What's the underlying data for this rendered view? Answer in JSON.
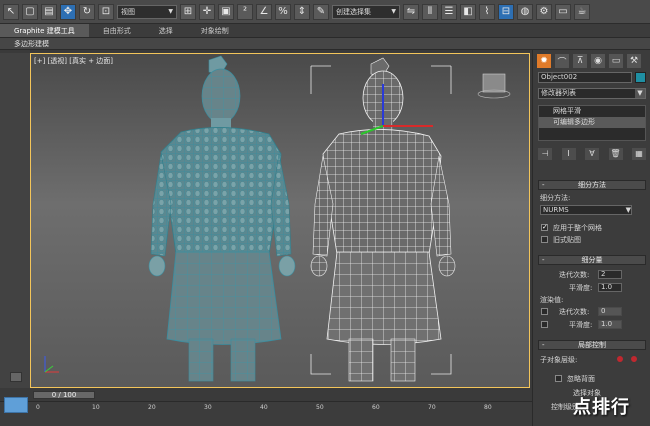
{
  "toolbar": {
    "view_dropdown": "视图",
    "named_selection": "创建选择集"
  },
  "ribbon": {
    "tabs": [
      "Graphite 建模工具",
      "自由形式",
      "选择",
      "对象绘制"
    ],
    "active_tab": "Graphite 建模工具",
    "sub_panel": "多边形建模"
  },
  "viewport": {
    "label": "[+] [透视] [真实 + 边面]"
  },
  "command_panel": {
    "object_name": "Object002",
    "object_color": "#1f8fa3",
    "modifier_list": "修改器列表",
    "stack": [
      "网格平滑",
      "可编辑多边形"
    ],
    "subdivision_method": {
      "header": "细分方法",
      "method_label": "细分方法:",
      "method_value": "NURMS",
      "apply_whole_mesh": "应用于整个网格",
      "old_style_mapping": "旧式贴图"
    },
    "subdivision_amount": {
      "header": "细分量",
      "iterations_label": "迭代次数:",
      "iterations_value": "2",
      "smoothness_label": "平滑度:",
      "smoothness_value": "1.0",
      "render_values_label": "渲染值:",
      "render_iterations_label": "迭代次数:",
      "render_iterations_value": "0",
      "render_smoothness_label": "平滑度:",
      "render_smoothness_value": "1.0"
    },
    "local_control": {
      "header": "局部控制",
      "sub_object_level": "子对象层级:",
      "ignore_backfacing": "忽略背面",
      "select_object": "选择对象",
      "control_level": "控制级别:"
    }
  },
  "timeline": {
    "slider_label": "0 / 100",
    "ticks": [
      "0",
      "10",
      "20",
      "30",
      "40",
      "50",
      "60",
      "70",
      "80"
    ]
  },
  "watermark": "点排行"
}
